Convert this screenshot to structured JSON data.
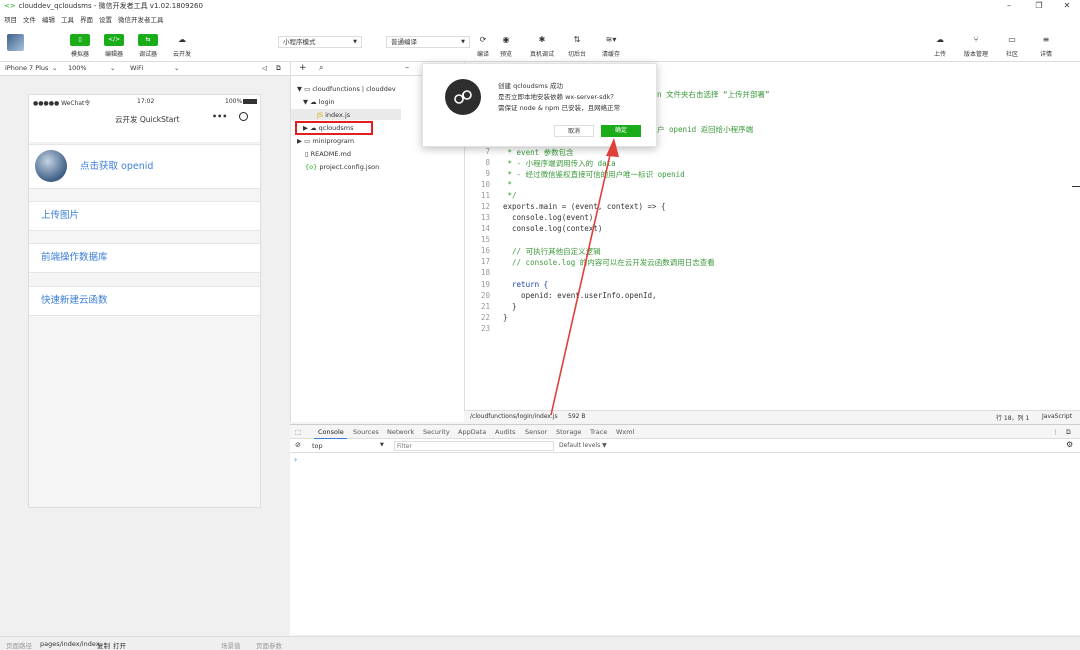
{
  "window": {
    "title": "clouddev_qcloudsms - 微信开发者工具 v1.02.1809260",
    "controls": [
      "–",
      "❐",
      "✕"
    ]
  },
  "menu": [
    "项目",
    "文件",
    "编辑",
    "工具",
    "界面",
    "设置",
    "微信开发者工具"
  ],
  "toolbar": {
    "left_buttons": [
      {
        "icon": "phone-icon",
        "label": "模拟器"
      },
      {
        "icon": "code-icon",
        "label": "编辑器"
      },
      {
        "icon": "debug-icon",
        "label": "调试器"
      },
      {
        "icon": "cloud-icon",
        "label": "云开发"
      }
    ],
    "mode_select": "小程序模式",
    "compile_select": "普通编译",
    "center_buttons": [
      {
        "icon": "refresh-icon",
        "label": "编译"
      },
      {
        "icon": "eye-icon",
        "label": "预览"
      },
      {
        "icon": "bug-icon",
        "label": "真机调试"
      },
      {
        "icon": "switch-icon",
        "label": "切后台"
      },
      {
        "icon": "layers-icon",
        "label": "清缓存"
      }
    ],
    "right_buttons": [
      {
        "icon": "upload-icon",
        "label": "上传"
      },
      {
        "icon": "branch-icon",
        "label": "版本管理"
      },
      {
        "icon": "community-icon",
        "label": "社区"
      },
      {
        "icon": "menu-icon",
        "label": "详情"
      }
    ]
  },
  "simulator": {
    "device": "iPhone 7 Plus",
    "zoom": "100%",
    "network": "WiFi",
    "status": {
      "carrier": "●●●●● WeChat令",
      "time": "17:02",
      "battery": "100%"
    },
    "nav_title": "云开发 QuickStart",
    "nav_menu": "•••",
    "items": [
      {
        "label": "点击获取 openid"
      },
      {
        "label": "上传图片"
      },
      {
        "label": "前端操作数据库"
      },
      {
        "label": "快速新建云函数"
      }
    ]
  },
  "file_tree": {
    "items": [
      {
        "label": "cloudfunctions | clouddev",
        "depth": 0,
        "arrow": "▼",
        "icon": "folder-icon"
      },
      {
        "label": "login",
        "depth": 1,
        "arrow": "▼",
        "icon": "cloud-folder-icon"
      },
      {
        "label": "index.js",
        "depth": 2,
        "arrow": "",
        "icon": "js-icon"
      },
      {
        "label": "qcloudsms",
        "depth": 1,
        "arrow": "▶",
        "icon": "cloud-folder-icon"
      },
      {
        "label": "miniprogram",
        "depth": 0,
        "arrow": "▶",
        "icon": "folder-icon"
      },
      {
        "label": "README.md",
        "depth": 0,
        "arrow": "",
        "icon": "file-icon"
      },
      {
        "label": "project.config.json",
        "depth": 0,
        "arrow": "",
        "icon": "json-icon"
      }
    ]
  },
  "editor": {
    "lines": [
      {
        "n": "",
        "text": "n 文件夹右击选择 “上传并部署”",
        "cls": "cm"
      },
      {
        "n": "",
        "text": "户 openid 返回给小程序端",
        "cls": "cm"
      },
      {
        "n": "7",
        "text": " * event 参数包含",
        "cls": "cm"
      },
      {
        "n": "8",
        "text": " * - 小程序端调用传入的 data",
        "cls": "cm"
      },
      {
        "n": "9",
        "text": " * - 经过微信鉴权直接可信的用户唯一标识 openid",
        "cls": "cm"
      },
      {
        "n": "10",
        "text": " *",
        "cls": "cm"
      },
      {
        "n": "11",
        "text": " */",
        "cls": "cm"
      },
      {
        "n": "12",
        "text": "exports.main = (event, context) => {",
        "cls": ""
      },
      {
        "n": "13",
        "text": "  console.log(event)",
        "cls": ""
      },
      {
        "n": "14",
        "text": "  console.log(context)",
        "cls": ""
      },
      {
        "n": "15",
        "text": "",
        "cls": ""
      },
      {
        "n": "16",
        "text": "  // 可执行其他自定义逻辑",
        "cls": "cm"
      },
      {
        "n": "17",
        "text": "  // console.log 的内容可以在云开发云函数调用日志查看",
        "cls": "cm"
      },
      {
        "n": "18",
        "text": "",
        "cls": ""
      },
      {
        "n": "19",
        "text": "  return {",
        "cls": "kw"
      },
      {
        "n": "20",
        "text": "    openid: event.userInfo.openId,",
        "cls": ""
      },
      {
        "n": "21",
        "text": "  }",
        "cls": ""
      },
      {
        "n": "22",
        "text": "}",
        "cls": ""
      },
      {
        "n": "23",
        "text": "",
        "cls": ""
      }
    ],
    "status_path": "/cloudfunctions/login/index.js",
    "status_size": "592 B",
    "status_pos": "行 18，列 1",
    "status_lang": "JavaScript"
  },
  "devtools": {
    "tabs": [
      "Console",
      "Sources",
      "Network",
      "Security",
      "AppData",
      "Audits",
      "Sensor",
      "Storage",
      "Trace",
      "Wxml"
    ],
    "context": "top",
    "filter_placeholder": "Filter",
    "levels": "Default levels ▼",
    "prompt": "›"
  },
  "footer": {
    "path_label": "页面路径",
    "path": "pages/index/index",
    "copy": "复制",
    "open": "打开",
    "scene": "场景值",
    "params": "页面参数"
  },
  "dialog": {
    "lines": [
      "创建 qcloudsms 成功",
      "是否立即本地安装依赖 wx-server-sdk？",
      "需保证 node & npm 已安装，且网络正常"
    ],
    "cancel": "取消",
    "confirm": "确定"
  },
  "colors": {
    "accent": "#1aad19",
    "link": "#3a7ed8",
    "highlight_box": "#e02020",
    "arrow": "#e0403a"
  }
}
